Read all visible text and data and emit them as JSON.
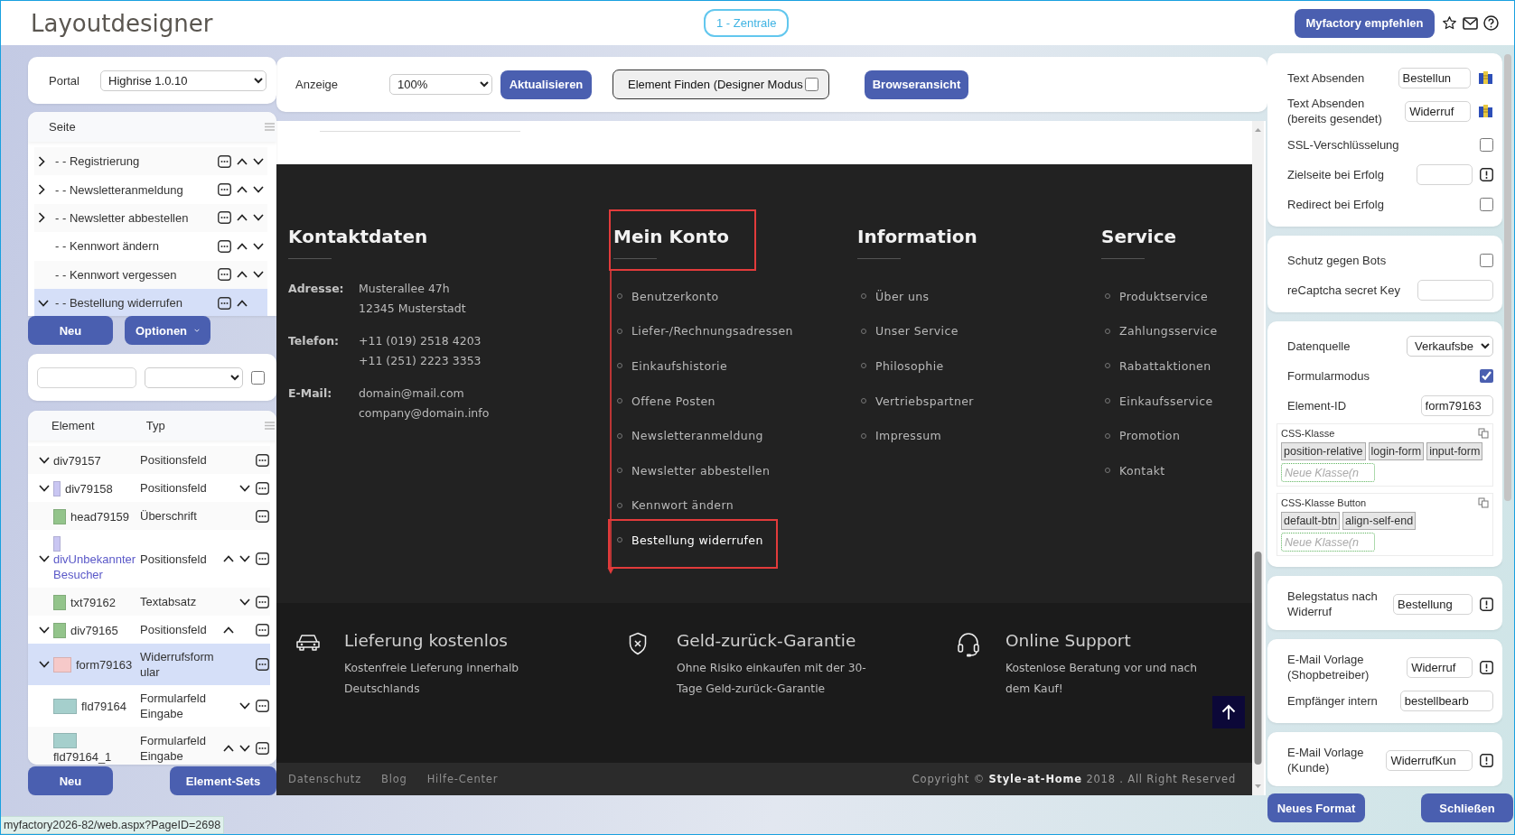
{
  "header": {
    "title": "Layoutdesigner",
    "portal_badge": "1 - Zentrale",
    "recommend_button": "Myfactory empfehlen"
  },
  "portal": {
    "label": "Portal",
    "value": "Highrise 1.0.10"
  },
  "pages": {
    "column": "Seite",
    "items": [
      {
        "label": "- - Registrierung",
        "has_children": true,
        "expanded": false,
        "selected": false,
        "up": true,
        "down": true
      },
      {
        "label": "- - Newsletteranmeldung",
        "has_children": true,
        "expanded": false,
        "selected": false,
        "up": true,
        "down": true
      },
      {
        "label": "- - Newsletter abbestellen",
        "has_children": true,
        "expanded": false,
        "selected": false,
        "up": true,
        "down": true
      },
      {
        "label": "- - Kennwort ändern",
        "has_children": false,
        "selected": false,
        "up": true,
        "down": true
      },
      {
        "label": "- - Kennwort vergessen",
        "has_children": false,
        "selected": false,
        "up": true,
        "down": true
      },
      {
        "label": "- - Bestellung widerrufen",
        "has_children": true,
        "expanded": true,
        "selected": true,
        "up": true,
        "down": false
      }
    ]
  },
  "page_buttons": [
    "Neu",
    "Optionen"
  ],
  "filter": {
    "checked": false
  },
  "elements": {
    "columns": [
      "Element",
      "Typ"
    ],
    "rows": [
      {
        "name": "div79157",
        "type": "Positionsfeld",
        "has_children": true,
        "expanded": true,
        "selected": false,
        "highlighted": false,
        "up": false,
        "down": false,
        "children": [
          {
            "name": "div79158",
            "type": "Positionsfeld",
            "color": "#c9c6f2",
            "has_children": true,
            "expanded": true,
            "selected": false,
            "highlighted": false,
            "up": false,
            "down": true,
            "children": [
              {
                "name": "head79159",
                "type": "Überschrift",
                "color": "#93c48b",
                "has_children": false,
                "selected": false,
                "highlighted": false,
                "up": false,
                "down": false
              }
            ]
          },
          {
            "name": "divUnbekannterBesucher",
            "type": "Positionsfeld",
            "color": "#c9c6f2",
            "has_children": true,
            "expanded": true,
            "selected": false,
            "highlighted": true,
            "up": true,
            "down": true,
            "children": [
              {
                "name": "txt79162",
                "type": "Textabsatz",
                "color": "#93c48b",
                "has_children": false,
                "selected": false,
                "highlighted": false,
                "up": false,
                "down": true
              },
              {
                "name": "div79165",
                "type": "Positionsfeld",
                "color": "#93c48b",
                "has_children": true,
                "expanded": true,
                "selected": false,
                "highlighted": false,
                "up": true,
                "down": false,
                "children": [
                  {
                    "name": "form79163",
                    "type": "Widerrufsformular",
                    "color": "#f6c9c9",
                    "has_children": true,
                    "expanded": true,
                    "selected": true,
                    "highlighted": false,
                    "up": false,
                    "down": false,
                    "children": [
                      {
                        "name": "fld79164",
                        "type": "Formularfeld Eingabe",
                        "color": "#a5cfcc",
                        "has_children": false,
                        "selected": false,
                        "highlighted": false,
                        "up": false,
                        "down": true
                      },
                      {
                        "name": "fld79164_1",
                        "type": "Formularfeld Eingabe",
                        "color": "#a5cfcc",
                        "has_children": false,
                        "selected": false,
                        "highlighted": false,
                        "up": true,
                        "down": true
                      }
                    ]
                  }
                ]
              }
            ]
          }
        ]
      }
    ]
  },
  "element_buttons": [
    "Neu",
    "Element-Sets"
  ],
  "status_url": "myfactory2026-82/web.aspx?PageID=2698",
  "toolbar": {
    "zoom_label": "Anzeige",
    "zoom": "100%",
    "refresh": "Aktualisieren",
    "find": "Element Finden (Designer Modus",
    "find_checked": false,
    "browser": "Browseransicht"
  },
  "preview": {
    "columns": [
      {
        "kind": "contact",
        "heading": "Kontaktdaten",
        "framed": false,
        "entries": [
          {
            "label": "Adresse:",
            "lines": [
              "Musterallee 47h",
              "12345 Musterstadt"
            ]
          },
          {
            "label": "Telefon:",
            "lines": [
              "+11 (019) 2518 4203",
              "+11 (251) 2223 3353"
            ]
          },
          {
            "label": "E-Mail:",
            "lines": [
              "domain@mail.com",
              "company@domain.info"
            ]
          }
        ]
      },
      {
        "kind": "links",
        "heading": "Mein Konto",
        "framed": true,
        "links": [
          {
            "label": "Benutzerkonto",
            "selected": false
          },
          {
            "label": "Liefer-/Rechnungsadressen",
            "selected": false
          },
          {
            "label": "Einkaufshistorie",
            "selected": false
          },
          {
            "label": "Offene Posten",
            "selected": false
          },
          {
            "label": "Newsletteranmeldung",
            "selected": false
          },
          {
            "label": "Newsletter abbestellen",
            "selected": false
          },
          {
            "label": "Kennwort ändern",
            "selected": false
          },
          {
            "label": "Bestellung widerrufen",
            "selected": true
          }
        ]
      },
      {
        "kind": "links",
        "heading": "Information",
        "framed": false,
        "links": [
          {
            "label": "Über uns",
            "selected": false
          },
          {
            "label": "Unser Service",
            "selected": false
          },
          {
            "label": "Philosophie",
            "selected": false
          },
          {
            "label": "Vertriebspartner",
            "selected": false
          },
          {
            "label": "Impressum",
            "selected": false
          }
        ]
      },
      {
        "kind": "links",
        "heading": "Service",
        "framed": false,
        "links": [
          {
            "label": "Produktservice",
            "selected": false
          },
          {
            "label": "Zahlungsservice",
            "selected": false
          },
          {
            "label": "Rabattaktionen",
            "selected": false
          },
          {
            "label": "Einkaufsservice",
            "selected": false
          },
          {
            "label": "Promotion",
            "selected": false
          },
          {
            "label": "Kontakt",
            "selected": false
          }
        ]
      }
    ],
    "features": [
      {
        "kind": "delivery",
        "title": "Lieferung kostenlos",
        "text": "Kostenfreie Lieferung innerhalb Deutschlands"
      },
      {
        "kind": "guarantee",
        "title": "Geld-zurück-Garantie",
        "text": "Ohne Risiko einkaufen mit der 30-Tage Geld-zurück-Garantie"
      },
      {
        "kind": "support",
        "title": "Online Support",
        "text": "Kostenlose Beratung vor und nach dem Kauf!"
      }
    ],
    "bottom_links": [
      "Datenschutz",
      "Blog",
      "Hilfe-Center"
    ],
    "copyright": "Copyright © **Style-at-Home** 2018 . All Right Reserved"
  },
  "properties": {
    "cards": [
      {
        "rows": [
          {
            "kind": "text",
            "label": "Text Absenden",
            "value": "Bestellun",
            "translatable": true,
            "hint": false
          },
          {
            "kind": "text",
            "label": "Text Absenden (bereits gesendet)",
            "value": "Widerruf",
            "translatable": true,
            "hint": false
          },
          {
            "kind": "checkbox",
            "label": "SSL-Verschlüsselung",
            "checked": false
          },
          {
            "kind": "text",
            "label": "Zielseite bei Erfolg",
            "translatable": false,
            "hint": true
          },
          {
            "kind": "checkbox",
            "label": "Redirect bei Erfolg",
            "checked": false
          }
        ]
      },
      {
        "rows": [
          {
            "kind": "checkbox",
            "label": "Schutz gegen Bots",
            "checked": false
          },
          {
            "kind": "text",
            "label": "reCaptcha secret Key",
            "translatable": false,
            "hint": false
          }
        ]
      },
      {
        "rows": [
          {
            "kind": "select",
            "label": "Datenquelle",
            "value": "Verkaufsbe"
          },
          {
            "kind": "checkbox",
            "label": "Formularmodus",
            "checked": true
          },
          {
            "kind": "text",
            "label": "Element-ID",
            "value": "form79163",
            "translatable": false,
            "hint": false
          },
          {
            "kind": "tags",
            "label": "CSS-Klasse",
            "tags": [
              "position-relative",
              "login-form",
              "input-form"
            ],
            "placeholder": "Neue Klasse(n"
          },
          {
            "kind": "tags",
            "label": "CSS-Klasse Button",
            "tags": [
              "default-btn",
              "align-self-end"
            ],
            "placeholder": "Neue Klasse(n"
          }
        ]
      },
      {
        "rows": [
          {
            "kind": "text",
            "label": "Belegstatus nach Widerruf",
            "value": "Bestellung",
            "translatable": false,
            "hint": true
          }
        ]
      },
      {
        "rows": [
          {
            "kind": "text",
            "label": "E-Mail Vorlage (Shopbetreiber)",
            "value": "Widerruf",
            "translatable": false,
            "hint": true
          },
          {
            "kind": "text",
            "label": "Empfänger intern",
            "value": "bestellbearb",
            "translatable": false,
            "hint": false
          }
        ]
      },
      {
        "rows": [
          {
            "kind": "text",
            "label": "E-Mail Vorlage (Kunde)",
            "value": "WiderrufKun",
            "translatable": false,
            "hint": true
          }
        ]
      }
    ],
    "buttons": [
      "Neues Format",
      "Schließen"
    ]
  }
}
